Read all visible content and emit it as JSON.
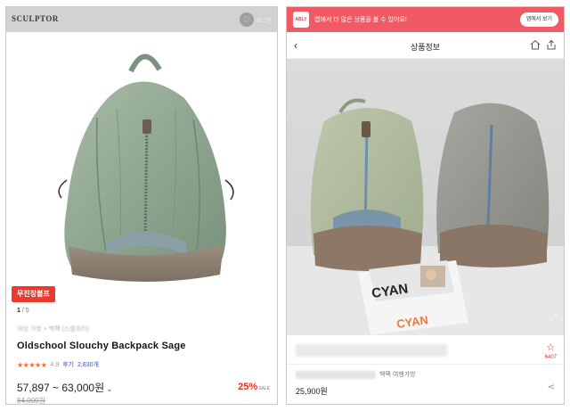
{
  "left": {
    "brand_logo": "SCULPTOR",
    "heart_icon": "heart-icon",
    "heart_count": "21.2만",
    "badge": "무진장블프",
    "pager": {
      "current": "1",
      "separator": "/",
      "total": "5"
    },
    "category": "여성 가방 > 백팩 (스컬프터)",
    "product_title": "Oldschool Slouchy Backpack Sage",
    "rating": {
      "stars": "★★★★★",
      "score": "4.9",
      "review_label": "후기",
      "review_count": "2,830개"
    },
    "price_range": "57,897 ~ 63,000원",
    "original_price": "84,000원",
    "discount": "25%",
    "discount_suffix": "SALE"
  },
  "right": {
    "banner": {
      "logo": "ABLY",
      "text": "앱에서 더 많은 상품을 볼 수 있어요!",
      "button": "앱에서 보기"
    },
    "nav": {
      "back_icon": "chevron-left-icon",
      "title": "상품정보",
      "home_icon": "home-icon",
      "share_icon": "share-icon"
    },
    "photo": {
      "book_title": "CYAN",
      "book_title_2": "CYAN"
    },
    "wish_count": "6407",
    "product_name_suffix": "백팩 여행가방",
    "price": "25,900원"
  },
  "colors": {
    "sale_red": "#e83224",
    "banner_pink": "#f05a65",
    "star_orange": "#ff6a1f",
    "review_blue": "#3a55c9"
  }
}
